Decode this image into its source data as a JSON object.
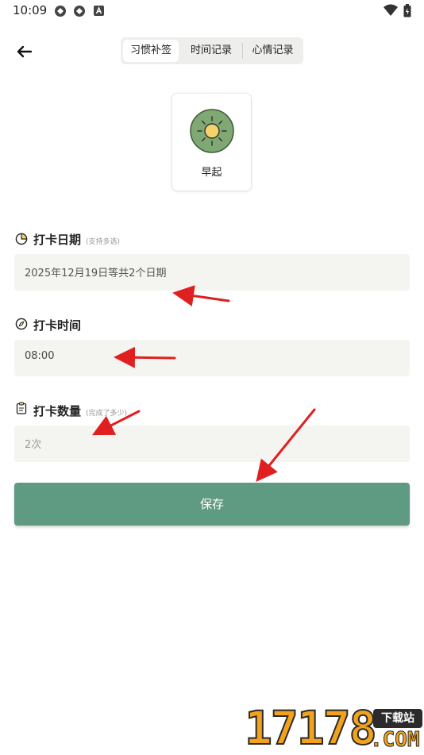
{
  "status_bar": {
    "time": "10:09"
  },
  "nav": {
    "tabs": [
      {
        "label": "习惯补签",
        "active": true
      },
      {
        "label": "时间记录",
        "active": false
      },
      {
        "label": "心情记录",
        "active": false
      }
    ]
  },
  "habit": {
    "name": "早起"
  },
  "sections": {
    "date": {
      "title": "打卡日期",
      "hint": "(支持多选)",
      "value": "2025年12月19日等共2个日期"
    },
    "time": {
      "title": "打卡时间",
      "value": "08:00"
    },
    "count": {
      "title": "打卡数量",
      "hint": "(完成了多少)",
      "placeholder": "2次"
    }
  },
  "save_label": "保存",
  "watermark": {
    "logo": "17178",
    "badge": "下载站",
    "site": ".COM"
  },
  "colors": {
    "accent": "#5f9a82",
    "field_bg": "#f4f4f0",
    "arrow": "#e02020",
    "icon_green": "#7fa874",
    "sun": "#f4d36a"
  }
}
